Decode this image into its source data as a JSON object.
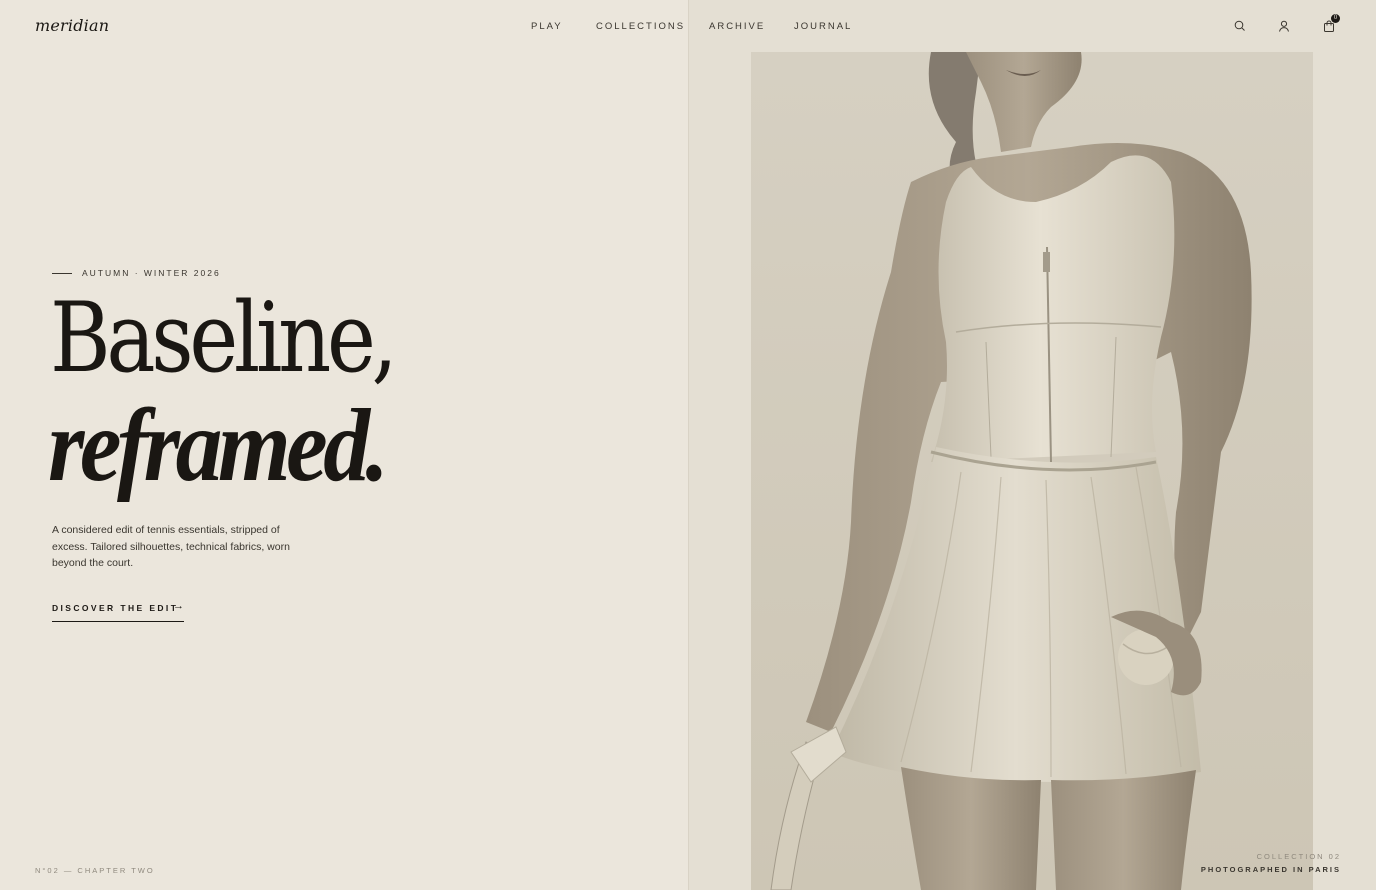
{
  "brand": {
    "logo": "meridian"
  },
  "nav": {
    "items": [
      "PLAY",
      "COLLECTIONS",
      "ARCHIVE",
      "JOURNAL"
    ]
  },
  "header_icons": {
    "search": "search-icon",
    "account": "user-icon",
    "cart": "bag-icon",
    "cart_count": "0"
  },
  "hero": {
    "season": "AUTUMN · WINTER 2026",
    "headline_line1": "Baseline,",
    "headline_line2": "reframed.",
    "description": "A considered edit of tennis essentials, stripped of excess. Tailored silhouettes, technical fabrics, worn beyond the court.",
    "cta_label": "DISCOVER THE EDIT",
    "cta_icon": "arrow-right-icon"
  },
  "footer": {
    "chapter": "N°02 — CHAPTER TWO"
  },
  "photo": {
    "caption_line1": "COLLECTION 02",
    "caption_line2": "PHOTOGRAPHED IN PARIS"
  },
  "colors": {
    "background": "#ebe6dc",
    "photo_panel": "#e4dfd3",
    "ink": "#1c1915",
    "muted": "#8f897e"
  }
}
